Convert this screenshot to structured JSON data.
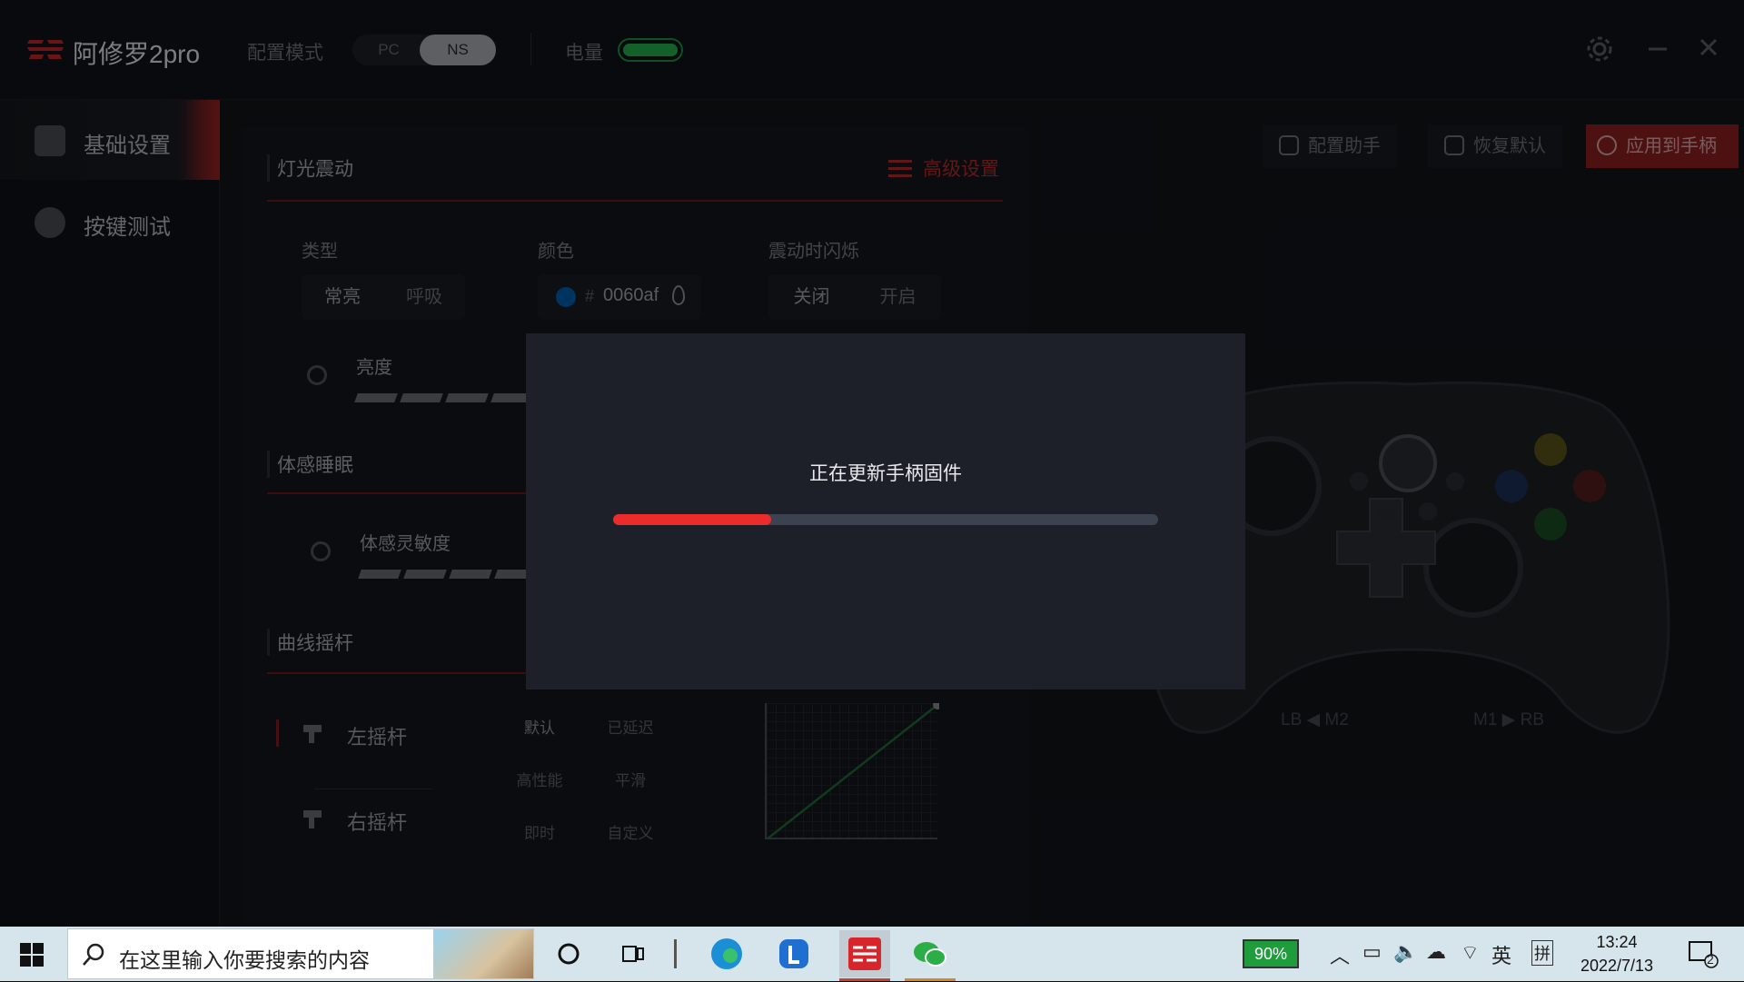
{
  "app": {
    "name": "阿修罗2pro",
    "mode_label": "配置模式",
    "mode_options": [
      "PC",
      "NS"
    ],
    "mode_selected": "NS",
    "battery_label": "电量",
    "battery_level": 1.0
  },
  "sidebar": {
    "items": [
      {
        "label": "基础设置",
        "icon": "gamepad-icon",
        "active": true
      },
      {
        "label": "按键测试",
        "icon": "dpad-icon",
        "active": false
      }
    ]
  },
  "toolbar": {
    "config_helper": "配置助手",
    "restore_default": "恢复默认",
    "apply": "应用到手柄"
  },
  "lighting": {
    "title": "灯光震动",
    "advanced": "高级设置",
    "type_label": "类型",
    "type_options": [
      "常亮",
      "呼吸"
    ],
    "color_label": "颜色",
    "color_prefix": "#",
    "color_value": "0060af",
    "flash_label": "震动时闪烁",
    "flash_options": [
      "关闭",
      "开启"
    ],
    "brightness_label": "亮度"
  },
  "motion": {
    "title": "体感睡眠",
    "sensitivity_label": "体感灵敏度"
  },
  "curve": {
    "title": "曲线摇杆",
    "left_stick": "左摇杆",
    "right_stick": "右摇杆",
    "presets": [
      "默认",
      "已延迟",
      "高性能",
      "平滑",
      "即时",
      "自定义"
    ]
  },
  "controller": {
    "left_label": "LB ◀ M2",
    "right_label": "M1 ▶ RB"
  },
  "modal": {
    "title": "正在更新手柄固件",
    "progress": 0.29
  },
  "taskbar": {
    "search_placeholder": "在这里输入你要搜索的内容",
    "battery_percent": "90%",
    "ime_lang": "英",
    "ime_mode": "拼",
    "time": "13:24",
    "date": "2022/7/13",
    "notification_count": "2"
  },
  "colors": {
    "accent": "#ec2b2b",
    "battery": "#23b04b",
    "led_color": "#0060af"
  }
}
